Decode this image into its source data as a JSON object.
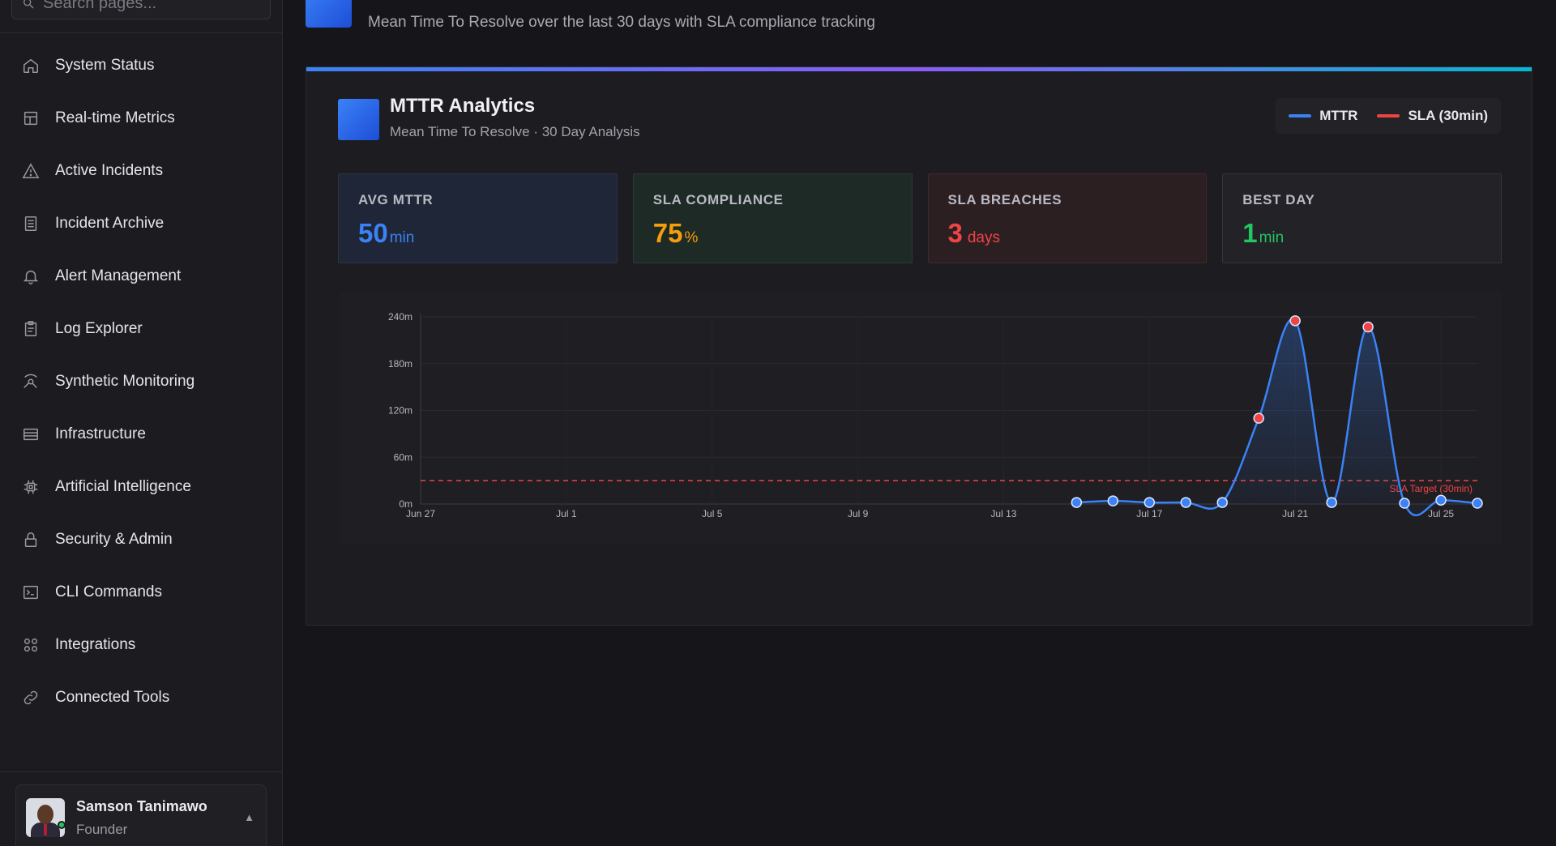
{
  "sidebar": {
    "search_placeholder": "Search pages...",
    "items": [
      {
        "label": "System Status",
        "icon": "home-icon"
      },
      {
        "label": "Real-time Metrics",
        "icon": "layout-icon"
      },
      {
        "label": "Active Incidents",
        "icon": "warning-icon"
      },
      {
        "label": "Incident Archive",
        "icon": "archive-icon"
      },
      {
        "label": "Alert Management",
        "icon": "bell-icon"
      },
      {
        "label": "Log Explorer",
        "icon": "clipboard-icon"
      },
      {
        "label": "Synthetic Monitoring",
        "icon": "radar-icon"
      },
      {
        "label": "Infrastructure",
        "icon": "server-icon"
      },
      {
        "label": "Artificial Intelligence",
        "icon": "chip-icon"
      },
      {
        "label": "Security & Admin",
        "icon": "lock-icon"
      },
      {
        "label": "CLI Commands",
        "icon": "terminal-icon"
      },
      {
        "label": "Integrations",
        "icon": "grid-icon"
      },
      {
        "label": "Connected Tools",
        "icon": "link-icon"
      }
    ],
    "user": {
      "name": "Samson Tanimawo",
      "role": "Founder",
      "status": "online"
    }
  },
  "header": {
    "subtitle": "Mean Time To Resolve over the last 30 days with SLA compliance tracking"
  },
  "card": {
    "title": "MTTR Analytics",
    "subtitle": "Mean Time To Resolve · 30 Day Analysis",
    "legend": [
      {
        "label": "MTTR",
        "color": "#3b82f6"
      },
      {
        "label": "SLA (30min)",
        "color": "#ef4444"
      }
    ],
    "stats": [
      {
        "label": "AVG MTTR",
        "value": "50",
        "unit": "min",
        "color": "#3b82f6",
        "bg": "#1f2637"
      },
      {
        "label": "SLA COMPLIANCE",
        "value": "75",
        "unit": "%",
        "color": "#f59e0b",
        "bg": "#1d2a25"
      },
      {
        "label": "SLA BREACHES",
        "value": "3",
        "unit": "days",
        "color": "#ef4444",
        "bg": "#2c1f22"
      },
      {
        "label": "BEST DAY",
        "value": "1",
        "unit": "min",
        "color": "#22c55e",
        "bg": "#222227"
      }
    ]
  },
  "chart_data": {
    "type": "line",
    "y_tick_labels": [
      "0m",
      "60m",
      "120m",
      "180m",
      "240m"
    ],
    "x_tick_labels": [
      "Jun 27",
      "Jul 1",
      "Jul 5",
      "Jul 9",
      "Jul 13",
      "Jul 17",
      "Jul 21",
      "Jul 25"
    ],
    "ylim": [
      0,
      240
    ],
    "x_range": [
      "Jun 27",
      "Jul 26"
    ],
    "sla_threshold": 30,
    "sla_label": "SLA Target (30min)",
    "series": [
      {
        "name": "MTTR",
        "color": "#3b82f6",
        "breach_color": "#ef4444",
        "points": [
          {
            "x": "Jul 15",
            "y": 2
          },
          {
            "x": "Jul 16",
            "y": 4
          },
          {
            "x": "Jul 17",
            "y": 2
          },
          {
            "x": "Jul 18",
            "y": 2
          },
          {
            "x": "Jul 19",
            "y": 2
          },
          {
            "x": "Jul 20",
            "y": 110
          },
          {
            "x": "Jul 21",
            "y": 235
          },
          {
            "x": "Jul 22",
            "y": 2
          },
          {
            "x": "Jul 23",
            "y": 227
          },
          {
            "x": "Jul 24",
            "y": 1
          },
          {
            "x": "Jul 25",
            "y": 5
          },
          {
            "x": "Jul 26",
            "y": 1
          }
        ]
      }
    ],
    "grid": true,
    "legend": "top-right"
  }
}
